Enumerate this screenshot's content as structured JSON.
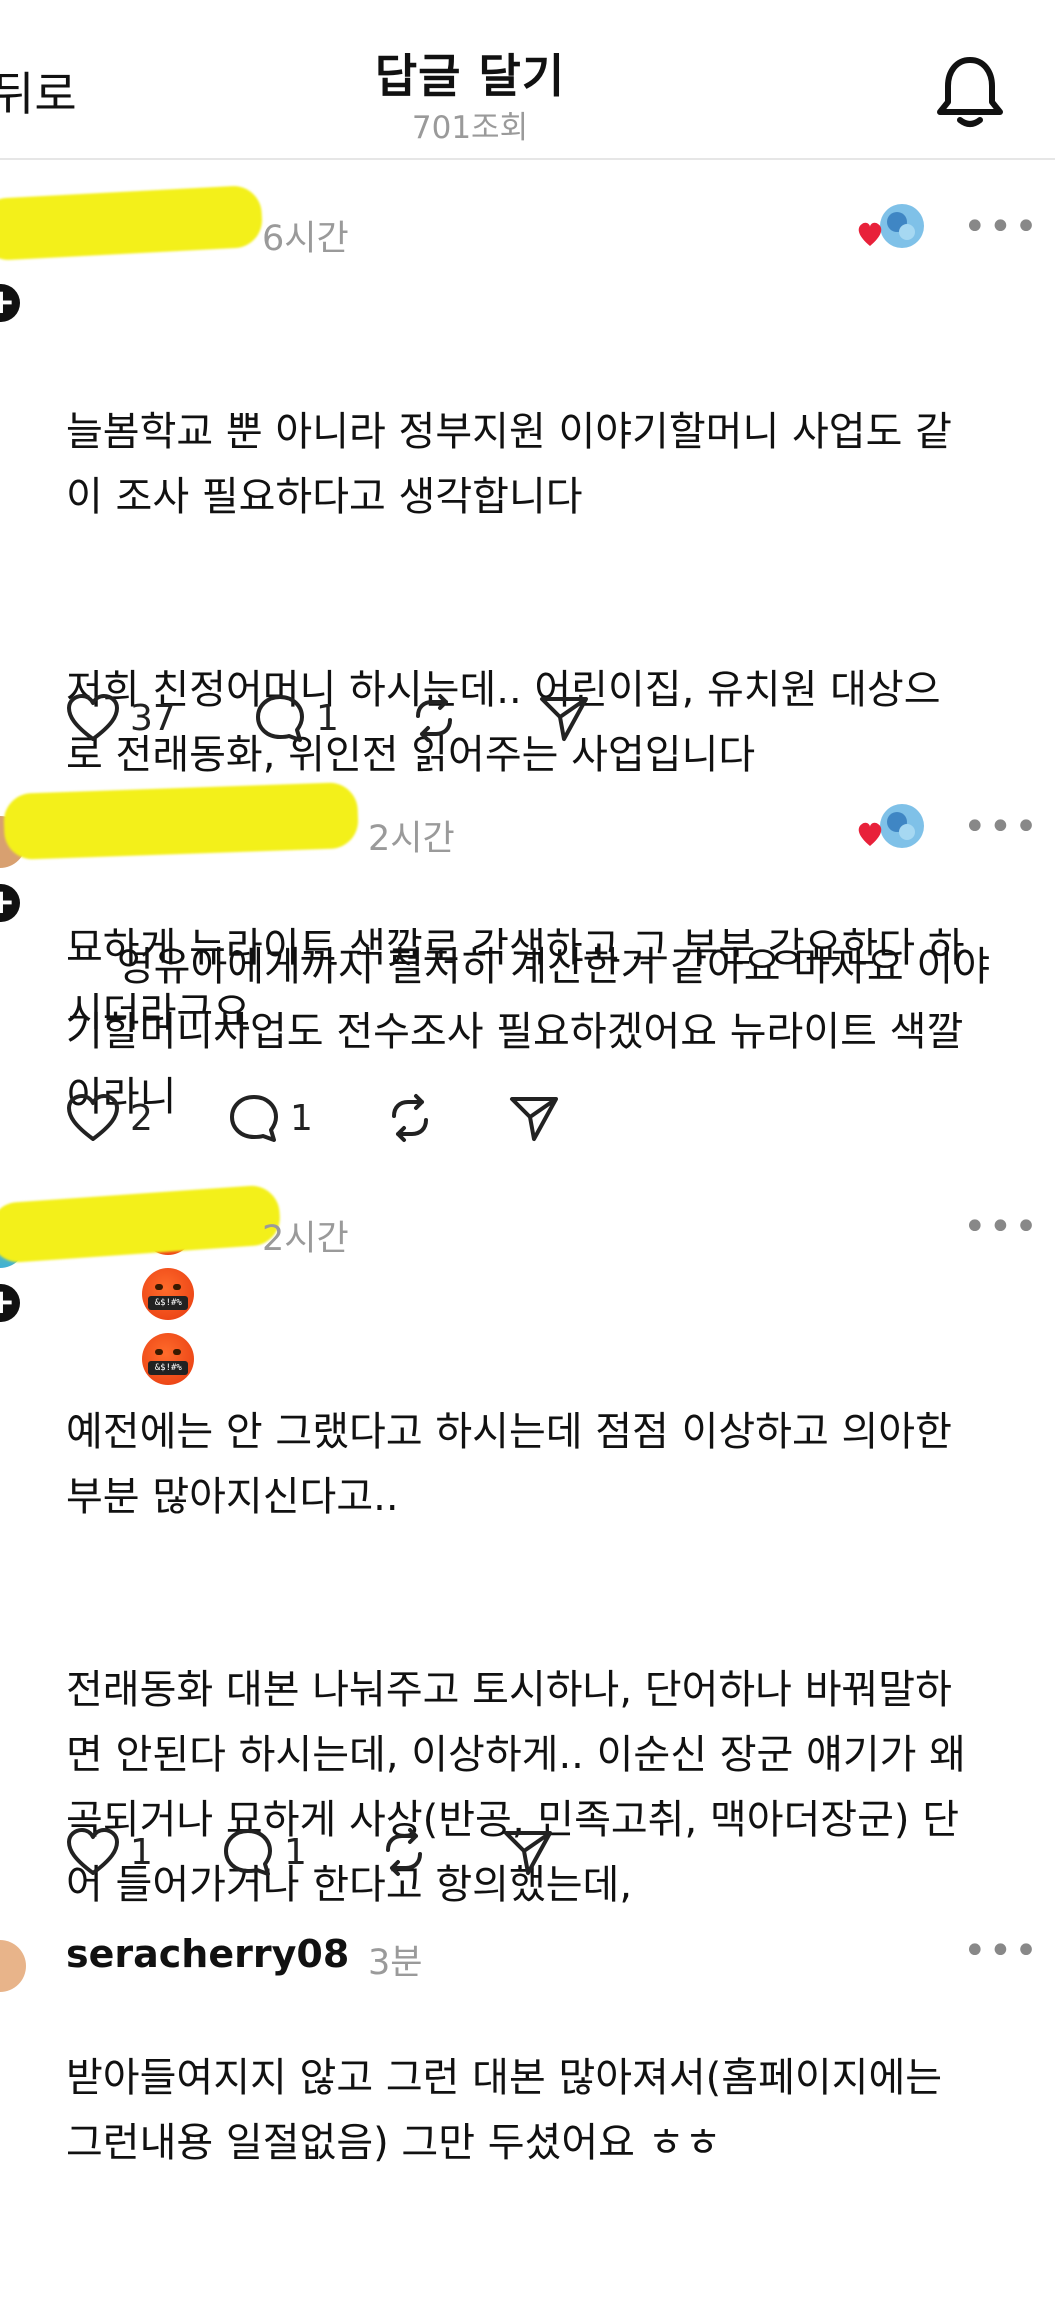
{
  "header": {
    "back_label": "뒤로",
    "title": "답글 달기",
    "views": "701조회"
  },
  "comments": [
    {
      "time": "6시간",
      "paragraphs": [
        "늘봄학교 뿐 아니라 정부지원 이야기할머니 사업도 같\n이 조사 필요하다고 생각합니다",
        "저희 친정어머니 하시는데.. 어린이집, 유치원 대상으\n로 전래동화, 위인전 읽어주는 사업입니다",
        "묘하게 뉴라이트 색깔로 각색하고 그 부분 강요한다 하\n시더라구요"
      ],
      "likes": "37",
      "replies": "1"
    },
    {
      "time": "2시간",
      "paragraphs": [
        "영유아에게까지 철저히 계산한거 같아요 마자요 이야\n기할머니사업도 전수조사 필요하겠어요 뉴라이트 색깔\n이라니"
      ],
      "emoji_band_text": "&$!#%",
      "likes": "2",
      "replies": "1"
    },
    {
      "time": "2시간",
      "paragraphs": [
        "예전에는 안 그랬다고 하시는데 점점 이상하고 의아한\n부분 많아지신다고..",
        "전래동화 대본 나눠주고 토시하나, 단어하나 바꿔말하\n면 안된다 하시는데, 이상하게.. 이순신 장군 얘기가 왜\n곡되거나 묘하게 사상(반공, 민족고취, 맥아더장군) 단\n어 들어가거나 한다고 항의했는데,",
        "받아들여지지 않고 그런 대본 많아져서(홈페이지에는\n그런내용 일절없음) 그만 두셨어요 ㅎㅎ"
      ],
      "likes": "1",
      "replies": "1"
    },
    {
      "username": "seracherry08",
      "time": "3분"
    }
  ],
  "icons": {
    "bell": "bell-icon",
    "like": "heart-icon",
    "reply": "comment-icon",
    "repost": "repost-icon",
    "share": "send-icon",
    "more": "more-dots-icon",
    "follow": "plus-icon"
  },
  "colors": {
    "highlight": "#f3f01a",
    "muted": "#9a9a9a",
    "liked_heart": "#e8213a"
  }
}
